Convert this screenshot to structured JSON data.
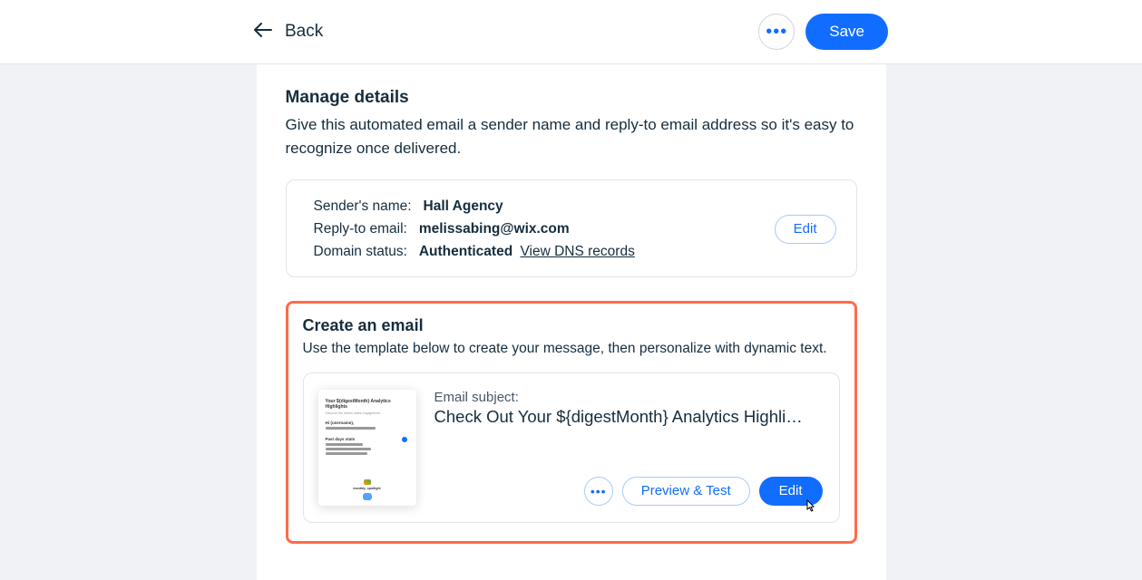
{
  "header": {
    "back_label": "Back",
    "save_label": "Save"
  },
  "manage": {
    "title": "Manage details",
    "description": "Give this automated email a sender name and reply-to email address so it's easy to recognize once delivered.",
    "sender_label": "Sender's name:",
    "sender_value": "Hall Agency",
    "reply_label": "Reply-to email:",
    "reply_value": "melissabing@wix.com",
    "domain_label": "Domain status:",
    "domain_value": "Authenticated",
    "dns_link": "View DNS records",
    "edit_label": "Edit"
  },
  "create": {
    "title": "Create an email",
    "description": "Use the template below to create your message, then personalize with dynamic text.",
    "subject_label": "Email subject:",
    "subject_value": "Check Out Your ${digestMonth} Analytics Highli…",
    "preview_label": "Preview & Test",
    "edit_label": "Edit"
  },
  "thumb": {
    "title": "Your ${digestMonth} Analytics Highlights",
    "hi": "Hi {username},",
    "stats": "Past days stats",
    "footer": "monthly_spotlight"
  }
}
